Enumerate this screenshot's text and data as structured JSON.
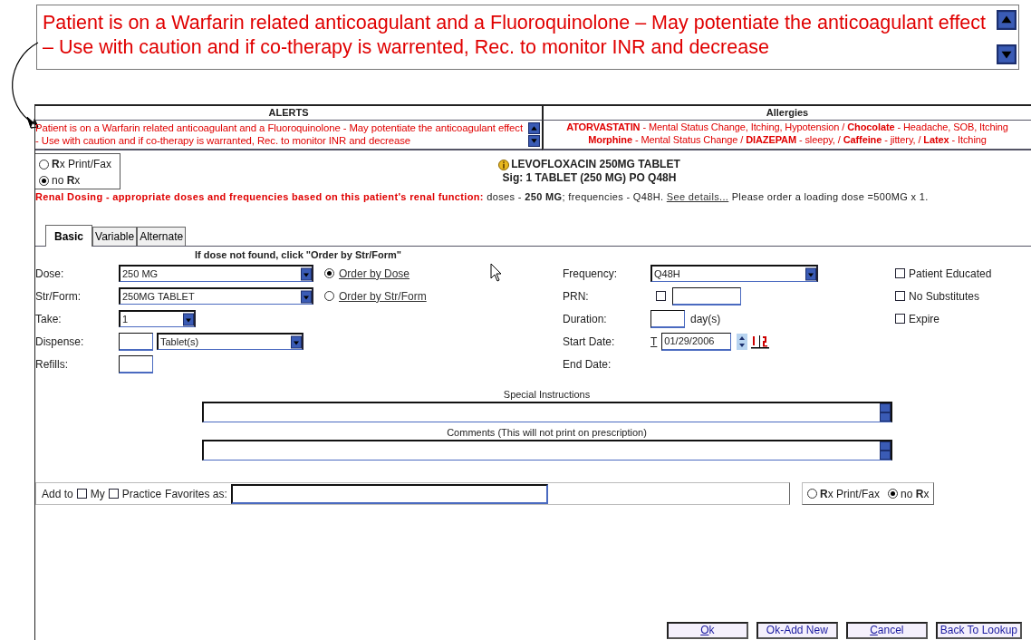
{
  "callout": {
    "text": "Patient is on a Warfarin related anticoagulant and a Fluoroquinolone – May potentiate the anticoagulant effect – Use with caution and if co-therapy is warrented, Rec. to monitor INR and decrease"
  },
  "alerts": {
    "title": "ALERTS",
    "text": "Patient is on a Warfarin related anticoagulant and a Fluoroquinolone - May potentiate the anticoagulant effect - Use with caution and if co-therapy is warranted, Rec. to monitor INR and decrease"
  },
  "allergies": {
    "title": "Allergies",
    "lines": [
      "**ATORVASTATIN** - Mental Status Change, Itching, Hypotension / **Chocolate** - Headache, SOB, Itching",
      "**Morphine** - Mental Status Change / **DIAZEPAM** - sleepy, / **Caffeine** - jittery, / **Latex** - Itching"
    ]
  },
  "print_options": [
    {
      "label": "**R**x Print/Fax",
      "selected": false
    },
    {
      "label": "no **R**x",
      "selected": true
    }
  ],
  "drug": {
    "name": "LEVOFLOXACIN 250MG TABLET",
    "sig": "Sig:  1 TABLET (250 MG) PO Q48H"
  },
  "renal": {
    "label": "Renal Dosing - appropriate doses and frequencies based on this patient's renal function:",
    "before": " doses - **250 MG**; frequencies - Q48H. ",
    "link": "See details...",
    "after": " Please order a loading dose =500MG x 1."
  },
  "tabs": [
    {
      "label": "Basic",
      "selected": true
    },
    {
      "label": "Variable",
      "selected": false
    },
    {
      "label": "Alternate",
      "selected": false
    }
  ],
  "hint": "If dose not found, click \"Order by Str/Form\"",
  "left_fields": [
    {
      "label": "Dose:",
      "kind": "select",
      "value": "250 MG",
      "option": {
        "label": "Order by Dose",
        "selected": true
      }
    },
    {
      "label": "Str/Form:",
      "kind": "select",
      "value": "250MG TABLET",
      "option": {
        "label": "Order by Str/Form",
        "selected": false
      }
    },
    {
      "label": "Take:",
      "kind": "short_select",
      "value": "1"
    },
    {
      "label": "Dispense:",
      "kind": "qty_unit",
      "unit": "Tablet(s)"
    },
    {
      "label": "Refills:",
      "kind": "text"
    }
  ],
  "right_fields": [
    {
      "label": "Frequency:",
      "kind": "select",
      "value": "Q48H"
    },
    {
      "label": "PRN:",
      "kind": "check_text",
      "checked": false
    },
    {
      "label": "Duration:",
      "kind": "text_unit",
      "unit": "day(s)"
    },
    {
      "label": "Start Date:",
      "kind": "date",
      "prefix": "T",
      "value": "01/29/2006"
    },
    {
      "label": "End Date:",
      "kind": "none"
    }
  ],
  "checkboxes": [
    {
      "label": "Patient Educated",
      "checked": false
    },
    {
      "label": "No Substitutes",
      "checked": false
    },
    {
      "label": "Expire",
      "checked": false
    }
  ],
  "special_instructions": {
    "label": "Special Instructions"
  },
  "comments": {
    "label": "Comments (This will not print on prescription)"
  },
  "favorites": {
    "prefix": "Add to",
    "options": [
      {
        "label": "My",
        "checked": false
      },
      {
        "label": "Practice",
        "checked": false
      }
    ],
    "label": "Favorites as:"
  },
  "bottom_print_options": [
    {
      "label": "**R**x Print/Fax",
      "selected": false
    },
    {
      "label": "no **R**x",
      "selected": true
    }
  ],
  "buttons": [
    {
      "label": "Ok",
      "mnemonic": true
    },
    {
      "label": "Ok-Add New",
      "mnemonic": false
    },
    {
      "label": "Cancel",
      "mnemonic": true
    },
    {
      "label": "Back To Lookup",
      "mnemonic": false
    }
  ]
}
